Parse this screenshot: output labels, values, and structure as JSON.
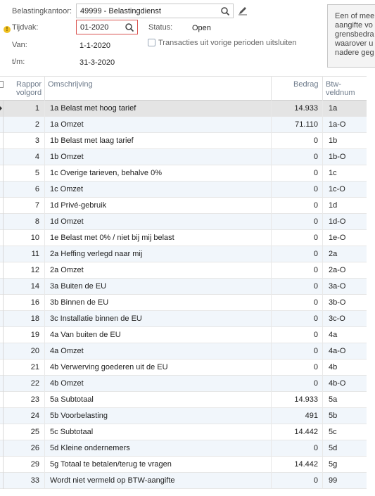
{
  "filters": {
    "belastingkantoor_label": "Belastingkantoor:",
    "belastingkantoor_value": "49999 - Belastingdienst",
    "tijdvak_label": "Tijdvak:",
    "tijdvak_value": "01-2020",
    "status_label": "Status:",
    "status_value": "Open",
    "van_label": "Van:",
    "van_value": "1-1-2020",
    "tm_label": "t/m:",
    "tm_value": "31-3-2020",
    "checkbox_label": "Transacties uit vorige perioden uitsluiten",
    "checkbox_checked": false
  },
  "info_panel": {
    "lines": [
      "Een of mee",
      "aangifte vo",
      "grensbedra",
      "waarover u",
      "nadere geg"
    ]
  },
  "table": {
    "headers": {
      "num": [
        "Rappor",
        "volgord"
      ],
      "desc": "Omschrijving",
      "amount": "Bedrag",
      "code": [
        "Btw-",
        "veldnum"
      ]
    },
    "rows": [
      {
        "num": "1",
        "desc": "1a Belast met hoog tarief",
        "amount": "14.933",
        "code": "1a"
      },
      {
        "num": "2",
        "desc": "1a Omzet",
        "amount": "71.110",
        "code": "1a-O"
      },
      {
        "num": "3",
        "desc": "1b Belast met laag tarief",
        "amount": "0",
        "code": "1b"
      },
      {
        "num": "4",
        "desc": "1b Omzet",
        "amount": "0",
        "code": "1b-O"
      },
      {
        "num": "5",
        "desc": "1c Overige tarieven, behalve 0%",
        "amount": "0",
        "code": "1c"
      },
      {
        "num": "6",
        "desc": "1c Omzet",
        "amount": "0",
        "code": "1c-O"
      },
      {
        "num": "7",
        "desc": "1d Privé-gebruik",
        "amount": "0",
        "code": "1d"
      },
      {
        "num": "8",
        "desc": "1d Omzet",
        "amount": "0",
        "code": "1d-O"
      },
      {
        "num": "10",
        "desc": "1e Belast met 0% / niet bij mij belast",
        "amount": "0",
        "code": "1e-O"
      },
      {
        "num": "11",
        "desc": "2a Heffing verlegd naar mij",
        "amount": "0",
        "code": "2a"
      },
      {
        "num": "12",
        "desc": "2a Omzet",
        "amount": "0",
        "code": "2a-O"
      },
      {
        "num": "14",
        "desc": "3a Buiten de EU",
        "amount": "0",
        "code": "3a-O"
      },
      {
        "num": "16",
        "desc": "3b Binnen de EU",
        "amount": "0",
        "code": "3b-O"
      },
      {
        "num": "18",
        "desc": "3c Installatie binnen de EU",
        "amount": "0",
        "code": "3c-O"
      },
      {
        "num": "19",
        "desc": "4a Van buiten de EU",
        "amount": "0",
        "code": "4a"
      },
      {
        "num": "20",
        "desc": "4a Omzet",
        "amount": "0",
        "code": "4a-O"
      },
      {
        "num": "21",
        "desc": "4b Verwerving goederen uit de EU",
        "amount": "0",
        "code": "4b"
      },
      {
        "num": "22",
        "desc": "4b Omzet",
        "amount": "0",
        "code": "4b-O"
      },
      {
        "num": "23",
        "desc": "5a Subtotaal",
        "amount": "14.933",
        "code": "5a"
      },
      {
        "num": "24",
        "desc": "5b Voorbelasting",
        "amount": "491",
        "code": "5b"
      },
      {
        "num": "25",
        "desc": "5c Subtotaal",
        "amount": "14.442",
        "code": "5c"
      },
      {
        "num": "26",
        "desc": "5d Kleine ondernemers",
        "amount": "0",
        "code": "5d"
      },
      {
        "num": "29",
        "desc": "5g Totaal te betalen/terug te vragen",
        "amount": "14.442",
        "code": "5g"
      },
      {
        "num": "33",
        "desc": "Wordt niet vermeld op BTW-aangifte",
        "amount": "0",
        "code": "99"
      }
    ],
    "selected_index": 0
  },
  "colors": {
    "row_alt": "#f1f6fb",
    "row_selected": "#e4e4e4",
    "error_border": "#d9534f",
    "warning": "#f0c020",
    "header_text": "#6d7a8a"
  }
}
